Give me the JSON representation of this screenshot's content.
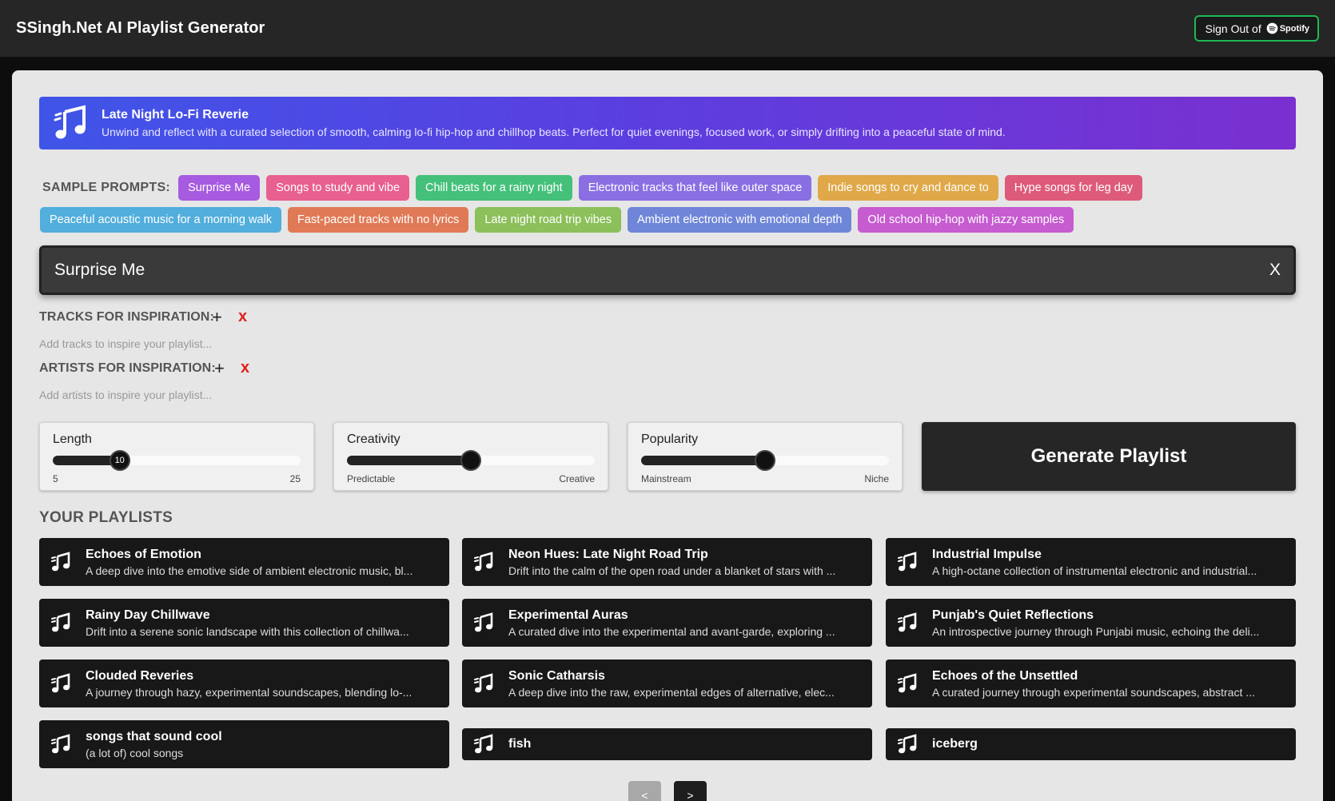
{
  "header": {
    "title": "SSingh.Net AI Playlist Generator",
    "signout_label": "Sign Out of",
    "spotify_label": "Spotify"
  },
  "banner": {
    "title": "Late Night Lo-Fi Reverie",
    "description": "Unwind and reflect with a curated selection of smooth, calming lo-fi hip-hop and chillhop beats. Perfect for quiet evenings, focused work, or simply drifting into a peaceful state of mind."
  },
  "prompts": {
    "label": "SAMPLE PROMPTS:",
    "items": [
      {
        "label": "Surprise Me",
        "color": "#a75be0"
      },
      {
        "label": "Songs to study and vibe",
        "color": "#e8608f"
      },
      {
        "label": "Chill beats for a rainy night",
        "color": "#45c07a"
      },
      {
        "label": "Electronic tracks that feel like outer space",
        "color": "#8a6fe3"
      },
      {
        "label": "Indie songs to cry and dance to",
        "color": "#e0a848"
      },
      {
        "label": "Hype songs for leg day",
        "color": "#de5a7a"
      },
      {
        "label": "Peaceful acoustic music for a morning walk",
        "color": "#52aedc"
      },
      {
        "label": "Fast-paced tracks with no lyrics",
        "color": "#e07a56"
      },
      {
        "label": "Late night road trip vibes",
        "color": "#8cc05a"
      },
      {
        "label": "Ambient electronic with emotional depth",
        "color": "#6f86d8"
      },
      {
        "label": "Old school hip-hop with jazzy samples",
        "color": "#c65cd0"
      }
    ]
  },
  "search": {
    "value": "Surprise Me",
    "clear_label": "X"
  },
  "tracks": {
    "label": "TRACKS FOR INSPIRATION:",
    "add_label": "+",
    "clear_label": "x",
    "placeholder": "Add tracks to inspire your playlist..."
  },
  "artists": {
    "label": "ARTISTS FOR INSPIRATION:",
    "add_label": "+",
    "clear_label": "x",
    "placeholder": "Add artists to inspire your playlist..."
  },
  "sliders": {
    "length": {
      "title": "Length",
      "min_label": "5",
      "max_label": "25",
      "value": "10",
      "fraction": 0.27
    },
    "creativity": {
      "title": "Creativity",
      "min_label": "Predictable",
      "max_label": "Creative",
      "value": "",
      "fraction": 0.5
    },
    "popularity": {
      "title": "Popularity",
      "min_label": "Mainstream",
      "max_label": "Niche",
      "value": "",
      "fraction": 0.5
    }
  },
  "generate_label": "Generate Playlist",
  "your_playlists": {
    "title": "YOUR PLAYLISTS",
    "items": [
      {
        "title": "Echoes of Emotion",
        "description": "A deep dive into the emotive side of ambient electronic music, bl..."
      },
      {
        "title": "Neon Hues: Late Night Road Trip",
        "description": "Drift into the calm of the open road under a blanket of stars with ..."
      },
      {
        "title": "Industrial Impulse",
        "description": "A high-octane collection of instrumental electronic and industrial..."
      },
      {
        "title": "Rainy Day Chillwave",
        "description": "Drift into a serene sonic landscape with this collection of chillwa..."
      },
      {
        "title": "Experimental Auras",
        "description": "A curated dive into the experimental and avant-garde, exploring ..."
      },
      {
        "title": "Punjab's Quiet Reflections",
        "description": "An introspective journey through Punjabi music, echoing the deli..."
      },
      {
        "title": "Clouded Reveries",
        "description": "A journey through hazy, experimental soundscapes, blending lo-..."
      },
      {
        "title": "Sonic Catharsis",
        "description": "A deep dive into the raw, experimental edges of alternative, elec..."
      },
      {
        "title": "Echoes of the Unsettled",
        "description": "A curated journey through experimental soundscapes, abstract ..."
      },
      {
        "title": "songs that sound cool",
        "description": "(a lot of) cool songs"
      },
      {
        "title": "fish",
        "description": ""
      },
      {
        "title": "iceberg",
        "description": ""
      }
    ]
  },
  "pagination": {
    "prev_label": "<",
    "next_label": ">",
    "prev_color": "#a8a8a8",
    "next_color": "#1e1e1e"
  }
}
